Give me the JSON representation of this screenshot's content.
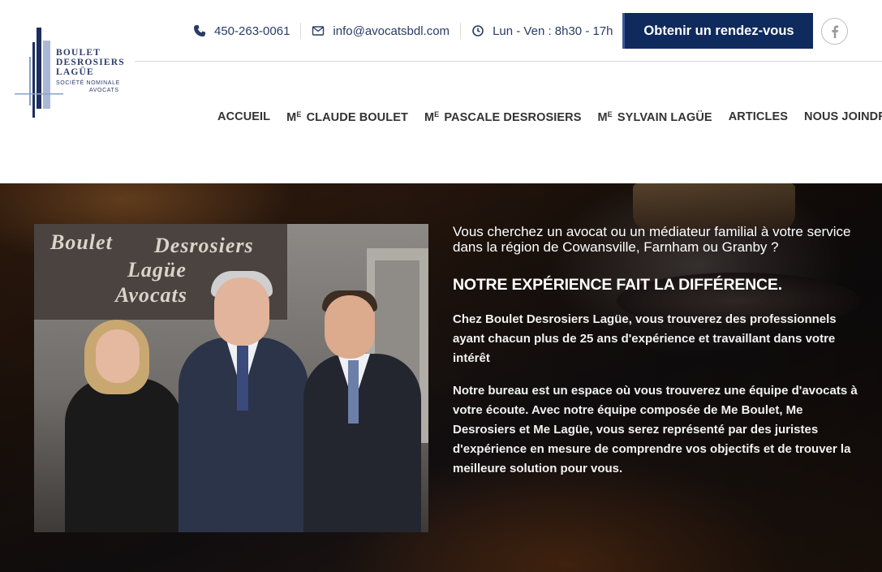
{
  "logo": {
    "line1": "BOULET",
    "line2": "DESROSIERS",
    "line3": "LAGÜE",
    "line4": "SOCIÉTÉ NOMINALE",
    "line5": "AVOCATS"
  },
  "topbar": {
    "phone": "450-263-0061",
    "email": "info@avocatsbdl.com",
    "hours": "Lun - Ven : 8h30 - 17h",
    "cta_label": "Obtenir un rendez-vous"
  },
  "nav": {
    "items": [
      {
        "label": "ACCUEIL"
      },
      {
        "prefix": "M",
        "sup": "E",
        "label": " CLAUDE BOULET"
      },
      {
        "prefix": "M",
        "sup": "E",
        "label": " PASCALE DESROSIERS"
      },
      {
        "prefix": "M",
        "sup": "E",
        "label": " SYLVAIN LAGÜE"
      },
      {
        "label": "ARTICLES"
      },
      {
        "label": "NOUS JOINDRE"
      }
    ]
  },
  "photo": {
    "sign_line1_a": "Boulet",
    "sign_line1_b": "Desrosiers",
    "sign_line2": "Lagüe",
    "sign_line3": "Avocats"
  },
  "hero": {
    "intro": "Vous cherchez un avocat ou un médiateur familial à votre service dans la région de Cowansville, Farnham ou Granby ?",
    "headline": "NOTRE EXPÉRIENCE FAIT LA DIFFÉRENCE.",
    "paragraph1": "Chez Boulet Desrosiers Lagüe, vous trouverez des professionnels ayant chacun plus de 25 ans d'expérience et travaillant dans votre intérêt",
    "paragraph2": "Notre bureau est un espace où vous trouverez une équipe d'avocats à votre écoute. Avec notre équipe composée de Me Boulet, Me Desrosiers et Me Lagüe, vous serez représenté par des juristes d'expérience en mesure de comprendre vos objectifs et de trouver la meilleure solution pour vous."
  },
  "colors": {
    "brand_navy": "#0f2a5c",
    "text_navy": "#2a3b66"
  },
  "icons": {
    "phone": "phone-icon",
    "email": "envelope-icon",
    "hours": "clock-icon",
    "social": "facebook-icon"
  }
}
